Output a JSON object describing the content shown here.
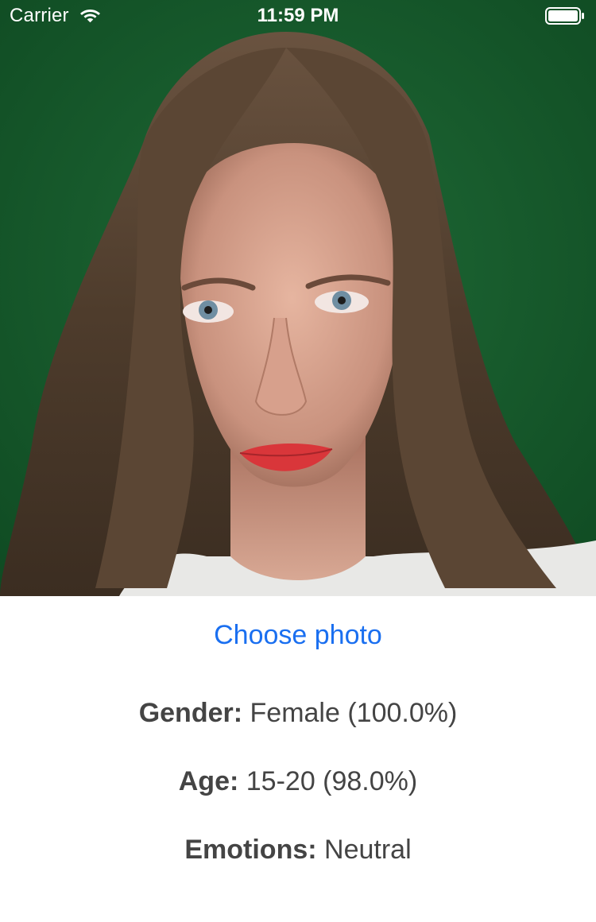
{
  "status_bar": {
    "carrier": "Carrier",
    "time": "11:59 PM",
    "icons": [
      "wifi-icon",
      "battery-icon"
    ]
  },
  "photo": {
    "background_color": "#1c5a30"
  },
  "choose_photo": {
    "label": "Choose photo",
    "color": "#1a6ff0"
  },
  "results": {
    "gender": {
      "label": "Gender:",
      "value": "Female (100.0%)"
    },
    "age": {
      "label": "Age:",
      "value": "15-20 (98.0%)"
    },
    "emotions": {
      "label": "Emotions:",
      "value": "Neutral"
    }
  }
}
